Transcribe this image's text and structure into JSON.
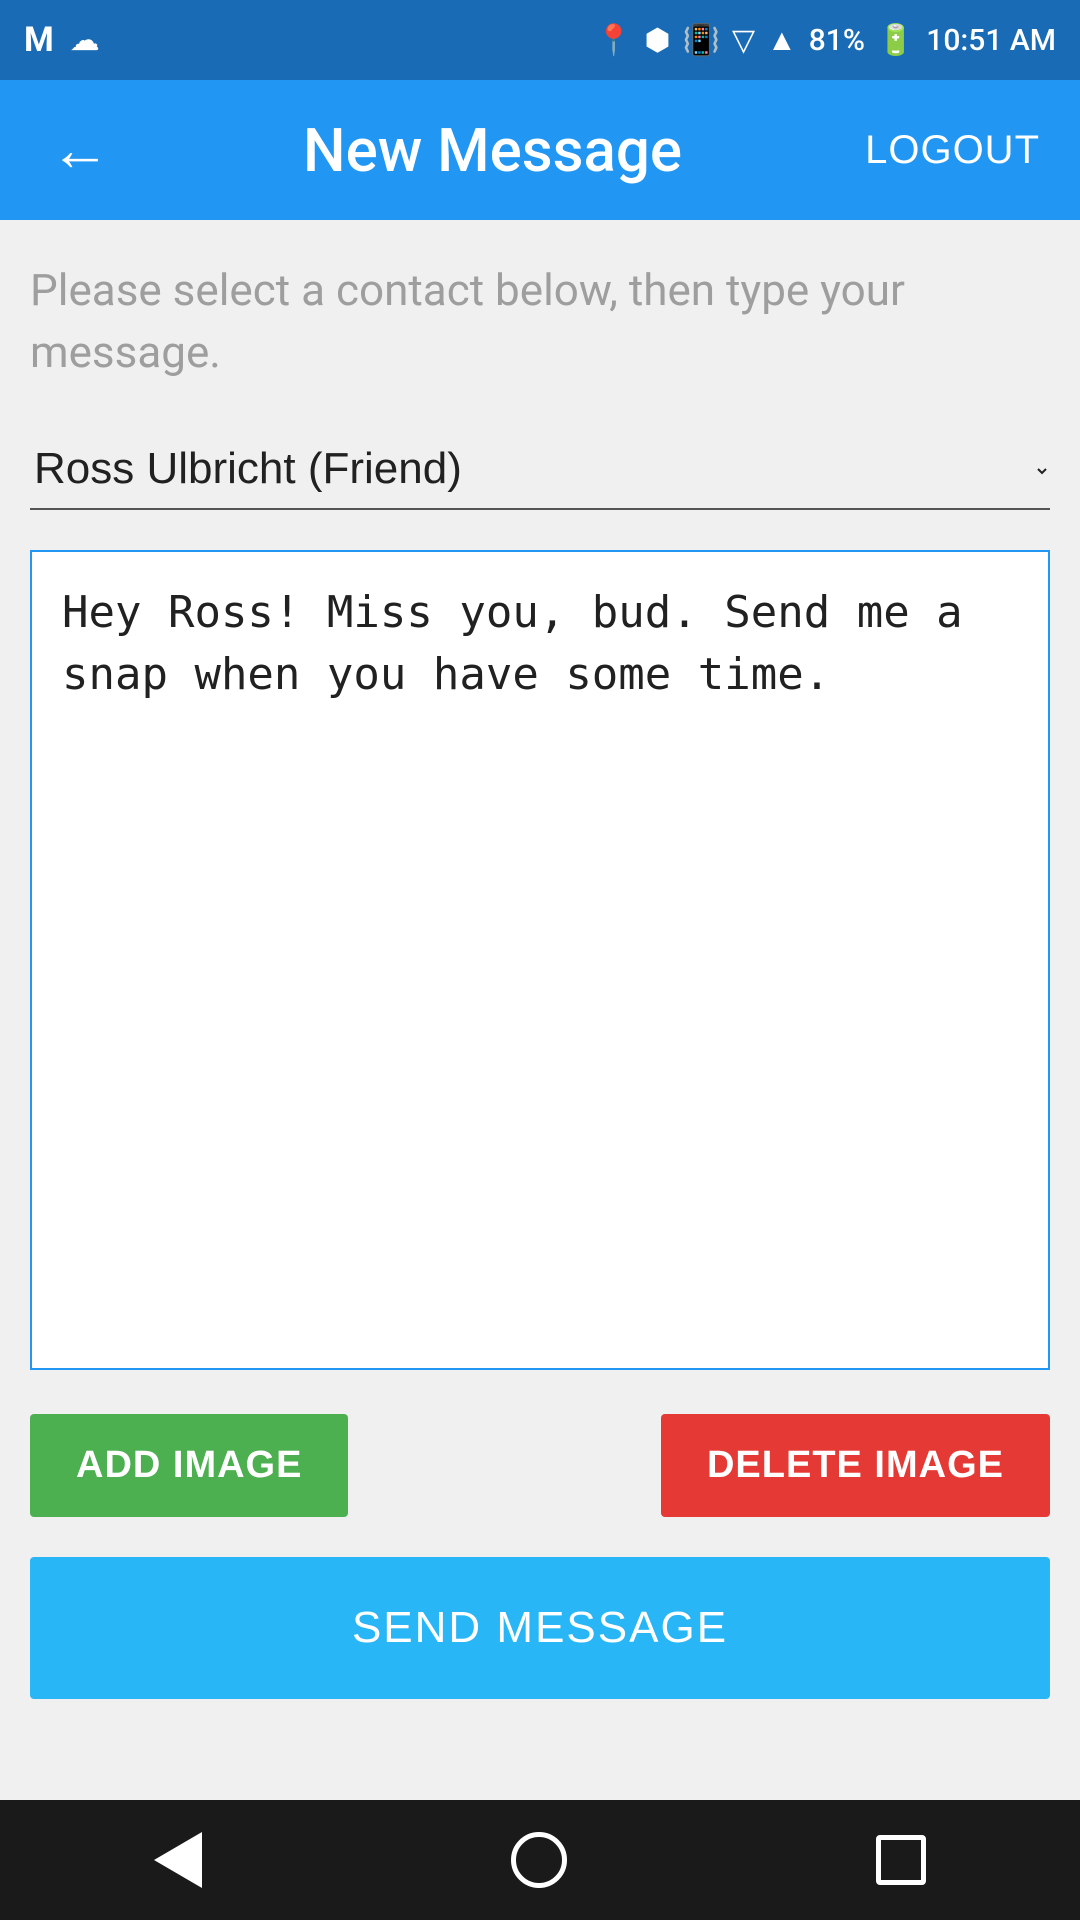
{
  "status_bar": {
    "battery": "81%",
    "time": "10:51 AM"
  },
  "app_bar": {
    "title": "New Message",
    "back_label": "←",
    "logout_label": "LOGOUT"
  },
  "form": {
    "instruction": "Please select a contact below, then type your message.",
    "contact_value": "Ross Ulbricht (Friend)",
    "message_value": "Hey Ross! Miss you, bud. Send me a snap when you have some time.",
    "add_image_label": "ADD IMAGE",
    "delete_image_label": "DELETE IMAGE",
    "send_message_label": "SEND MESSAGE"
  },
  "nav": {
    "back_label": "back",
    "home_label": "home",
    "recents_label": "recents"
  }
}
